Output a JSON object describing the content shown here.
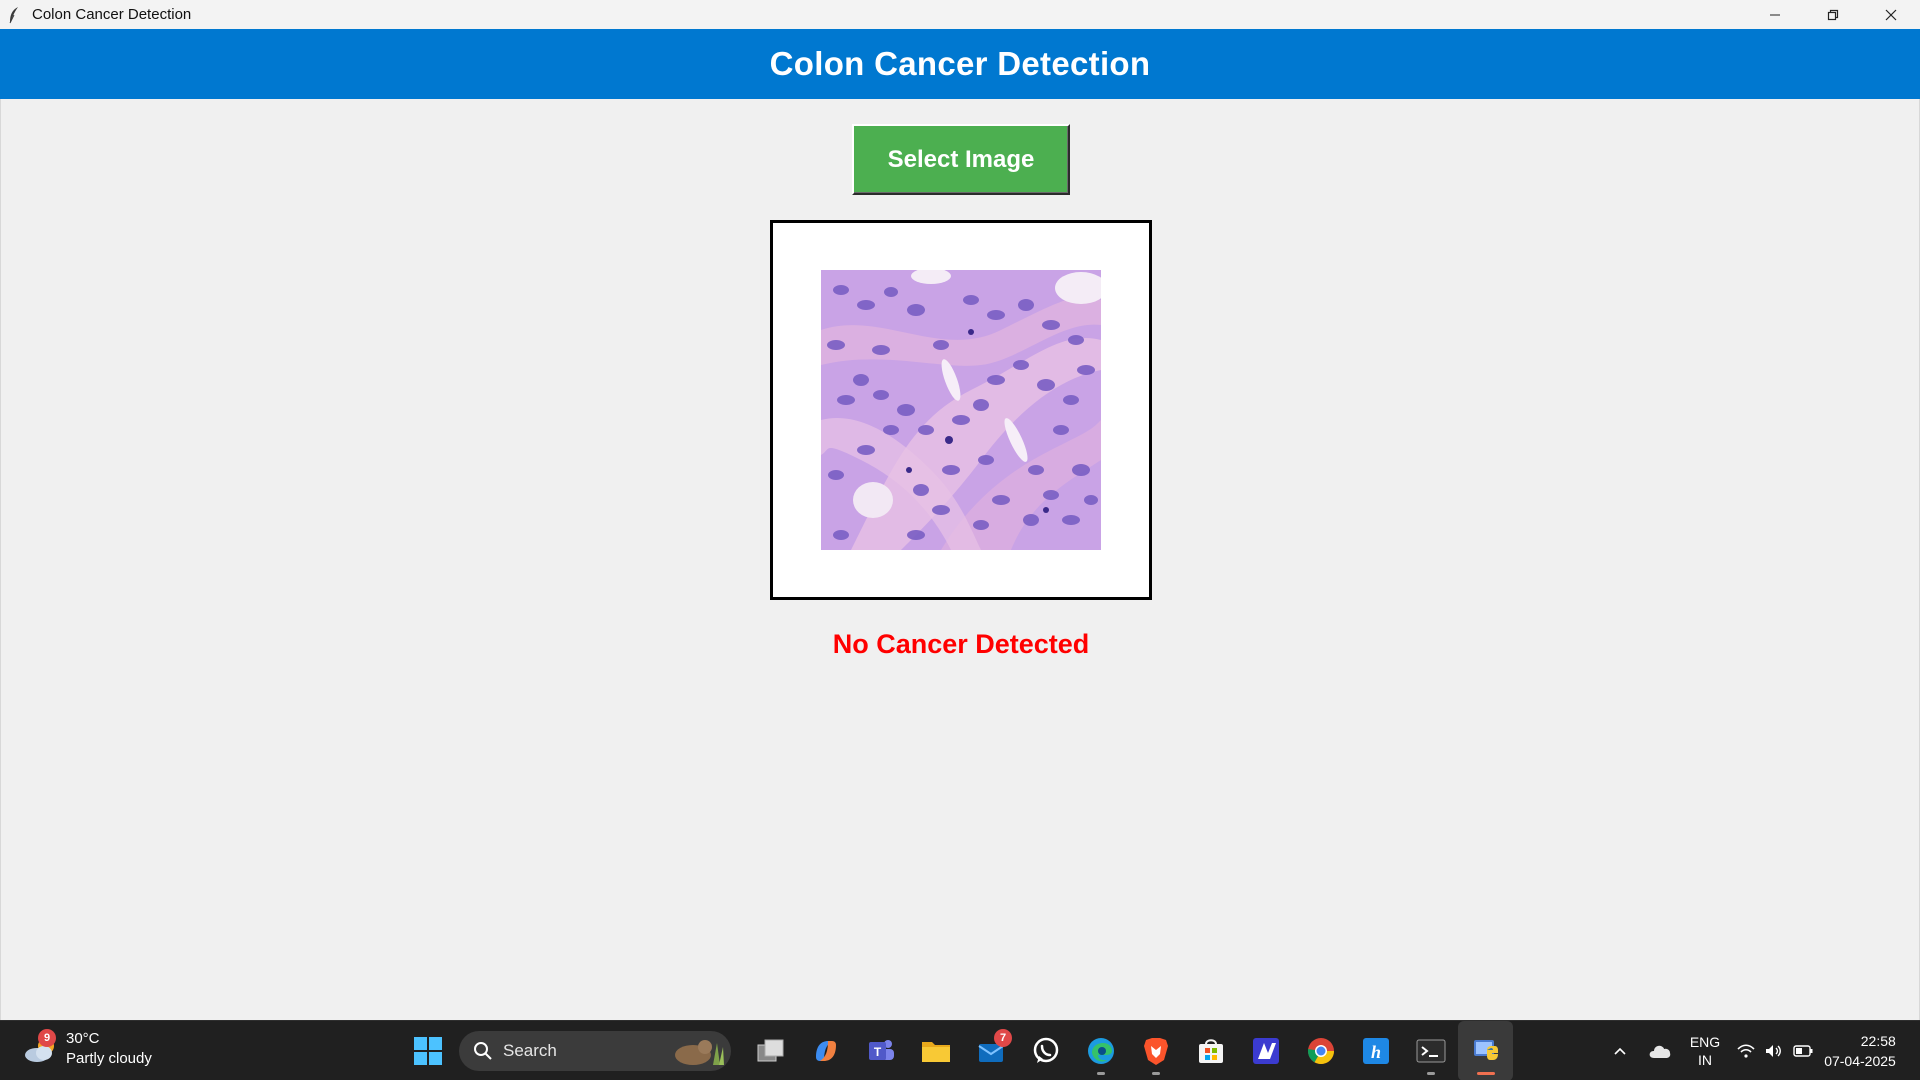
{
  "window": {
    "title": "Colon Cancer Detection"
  },
  "header": {
    "title": "Colon Cancer Detection"
  },
  "main": {
    "select_button_label": "Select Image",
    "result_text": "No Cancer Detected",
    "result_color": "#ff0000",
    "image_icon": "histology-image"
  },
  "colors": {
    "banner": "#0078d0",
    "button": "#4caf50",
    "background": "#f0f0f0"
  },
  "taskbar": {
    "weather": {
      "badge": "9",
      "temperature": "30°C",
      "condition": "Partly cloudy"
    },
    "search_label": "Search",
    "mail_badge": "7",
    "language_line1": "ENG",
    "language_line2": "IN",
    "time": "22:58",
    "date": "07-04-2025"
  }
}
